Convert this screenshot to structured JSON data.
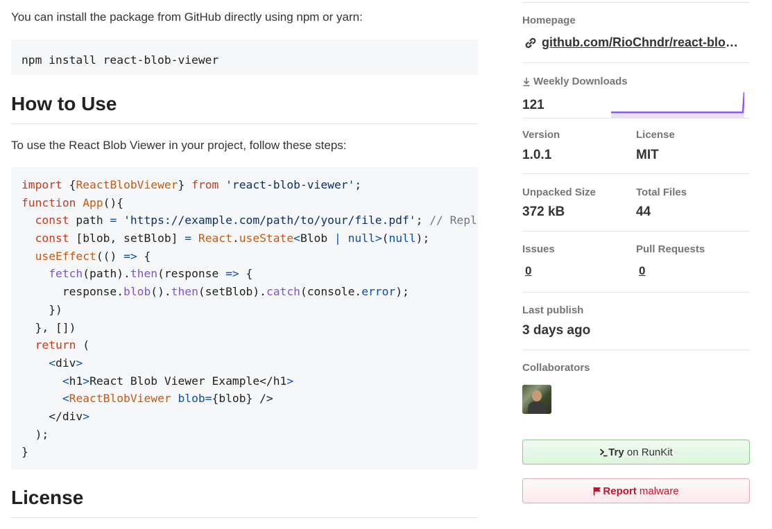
{
  "readme": {
    "intro_install": "You can install the package from GitHub directly using npm or yarn:",
    "install_command": "npm install react-blob-viewer",
    "heading_how_to_use": "How to Use",
    "intro_usage": "To use the React Blob Viewer in your project, follow these steps:",
    "code_lines": [
      [
        {
          "t": "import",
          "c": "kw"
        },
        {
          "t": " {"
        },
        {
          "t": "ReactBlobViewer",
          "c": "fn"
        },
        {
          "t": "} "
        },
        {
          "t": "from",
          "c": "kw"
        },
        {
          "t": " "
        },
        {
          "t": "'react-blob-viewer'",
          "c": "str"
        },
        {
          "t": ";"
        }
      ],
      [
        {
          "t": "function",
          "c": "kw"
        },
        {
          "t": " "
        },
        {
          "t": "App",
          "c": "fn"
        },
        {
          "t": "(){"
        }
      ],
      [
        {
          "t": "  "
        },
        {
          "t": "const",
          "c": "kw"
        },
        {
          "t": " path "
        },
        {
          "t": "=",
          "c": "op"
        },
        {
          "t": " "
        },
        {
          "t": "'https://example.com/path/to/your/file.pdf'",
          "c": "str"
        },
        {
          "t": "; "
        },
        {
          "t": "// Replace",
          "c": "cm"
        }
      ],
      [
        {
          "t": "  "
        },
        {
          "t": "const",
          "c": "kw"
        },
        {
          "t": " [blob, setBlob] "
        },
        {
          "t": "=",
          "c": "op"
        },
        {
          "t": " "
        },
        {
          "t": "React",
          "c": "fn"
        },
        {
          "t": "."
        },
        {
          "t": "useState",
          "c": "fn"
        },
        {
          "t": "<",
          "c": "op"
        },
        {
          "t": "Blob "
        },
        {
          "t": "|",
          "c": "op"
        },
        {
          "t": " "
        },
        {
          "t": "null",
          "c": "op"
        },
        {
          "t": ">",
          "c": "op"
        },
        {
          "t": "("
        },
        {
          "t": "null",
          "c": "op"
        },
        {
          "t": ");"
        }
      ],
      [
        {
          "t": "  "
        },
        {
          "t": "useEffect",
          "c": "fn"
        },
        {
          "t": "(() "
        },
        {
          "t": "=>",
          "c": "op"
        },
        {
          "t": " {"
        }
      ],
      [
        {
          "t": "    "
        },
        {
          "t": "fetch",
          "c": "pr"
        },
        {
          "t": "(path)."
        },
        {
          "t": "then",
          "c": "pr"
        },
        {
          "t": "(response "
        },
        {
          "t": "=>",
          "c": "op"
        },
        {
          "t": " {"
        }
      ],
      [
        {
          "t": "      response."
        },
        {
          "t": "blob",
          "c": "pr"
        },
        {
          "t": "()."
        },
        {
          "t": "then",
          "c": "pr"
        },
        {
          "t": "(setBlob)."
        },
        {
          "t": "catch",
          "c": "pr"
        },
        {
          "t": "(console."
        },
        {
          "t": "error",
          "c": "op"
        },
        {
          "t": ");"
        }
      ],
      [
        {
          "t": "    })"
        }
      ],
      [
        {
          "t": "  }, [])"
        }
      ],
      [
        {
          "t": "  "
        },
        {
          "t": "return",
          "c": "kw"
        },
        {
          "t": " ("
        }
      ],
      [
        {
          "t": "    "
        },
        {
          "t": "<",
          "c": "tg"
        },
        {
          "t": "div"
        },
        {
          "t": ">",
          "c": "tg"
        }
      ],
      [
        {
          "t": "      "
        },
        {
          "t": "<",
          "c": "tg"
        },
        {
          "t": "h1"
        },
        {
          "t": ">",
          "c": "tg"
        },
        {
          "t": "React Blob Viewer Example</h1"
        },
        {
          "t": ">",
          "c": "tg"
        }
      ],
      [
        {
          "t": "      "
        },
        {
          "t": "<",
          "c": "tg"
        },
        {
          "t": "ReactBlobViewer",
          "c": "fn"
        },
        {
          "t": " "
        },
        {
          "t": "blob=",
          "c": "op"
        },
        {
          "t": "{blob} />"
        }
      ],
      [
        {
          "t": "    </div"
        },
        {
          "t": ">",
          "c": "tg"
        }
      ],
      [
        {
          "t": "  );"
        }
      ],
      [
        {
          "t": "}"
        }
      ]
    ],
    "heading_license": "License"
  },
  "sidebar": {
    "homepage_label": "Homepage",
    "homepage_link": "github.com/RioChndr/react-blob-viewer",
    "weekly_downloads_label": "Weekly Downloads",
    "weekly_downloads_value": "121",
    "version_label": "Version",
    "version_value": "1.0.1",
    "license_label": "License",
    "license_value": "MIT",
    "unpacked_size_label": "Unpacked Size",
    "unpacked_size_value": "372 kB",
    "total_files_label": "Total Files",
    "total_files_value": "44",
    "issues_label": "Issues",
    "issues_value": "0",
    "pull_requests_label": "Pull Requests",
    "pull_requests_value": "0",
    "last_publish_label": "Last publish",
    "last_publish_value": "3 days ago",
    "collaborators_label": "Collaborators",
    "runkit_button_strong": "Try",
    "runkit_button_rest": " on RunKit",
    "report_button_strong": "Report",
    "report_button_rest": " malware"
  },
  "colors": {
    "sparkline": "#8956ff",
    "sparkline_fill": "#e8e1f7",
    "keyword": "#c73a1d",
    "string": "#0a3069",
    "report": "#c0152a"
  },
  "icons": [
    "link-icon",
    "download-icon",
    "terminal-prompt-icon",
    "flag-icon"
  ]
}
